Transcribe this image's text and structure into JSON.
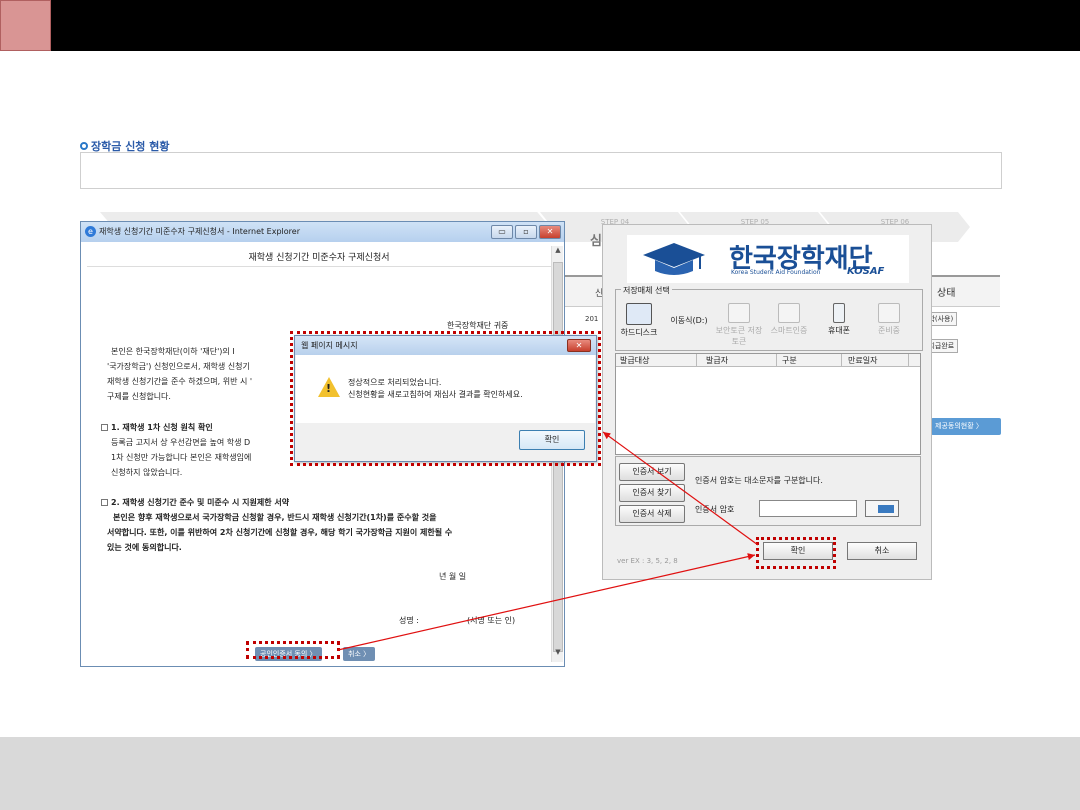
{
  "background": {
    "section_title": "장학금 신청 현황",
    "steps": [
      "STEP 04",
      "STEP 05",
      "STEP 06"
    ],
    "step_big": "심",
    "table": {
      "header_col1": "신",
      "header_status": "상태",
      "row1_text": "201",
      "row1_badge": "결학(사용)",
      "row2_badge": "학지급완료"
    },
    "blue_button": "제공동의현황 〉"
  },
  "ie_window": {
    "title": "재학생 신청기간 미준수자 구제신청서 - Internet Explorer",
    "doc_title": "재학생 신청기간 미준수자 구제신청서",
    "doc_to": "한국장학재단 귀중",
    "para1": "본인은  한국장학재단(이하  '재단')의   I",
    "para1b": "'국가장학금') 신청인으로서,  재학생  신청기",
    "para1c": "재학생 신청기간을 준수 하겠으며, 위반 시 '",
    "para1d": "구제를 신청합니다.",
    "sec1_title": "1. 재학생 1차 신청 원칙 확인",
    "sec1_a": "등록금 고지서 상 우선감면을 높여 학생 D",
    "sec1_b": "1차  신청만  가능합니다  본인은  재학생임에",
    "sec1_c": "신청하지 않았습니다.",
    "sec2_title": "2. 재학생 신청기간 준수 및 미준수 시 지원제한 서약",
    "sec2_a": "본인은 향후 재학생으로서 국가장학금 신청할 경우, 반드시 재학생 신청기간(1차)를 준수할 것을",
    "sec2_b": "서약합니다. 또한, 이를 위반하여 2차 신청기간에 신청할 경우, 해당 학기 국가장학금 지원이 제한될 수",
    "sec2_c": "있는 것에 동의합니다.",
    "date": "년      월      일",
    "sign_label": "성명 :",
    "sign_hint": "(서명 또는 인)",
    "btn_cert": "공인인증서 동의 〉",
    "btn_cancel": "취소 〉",
    "min": "▭",
    "max": "▫",
    "close": "✕"
  },
  "cert_window": {
    "logo_name": "한국장학재단",
    "logo_sub": "Korea Student Aid Foundation",
    "logo_kosaf": "KOSAF",
    "media_legend": "저장매체 선택",
    "media": [
      {
        "label": "하드디스크",
        "icon": "hard-disk-icon"
      },
      {
        "label": "이동식(D:)",
        "icon": "removable-icon"
      },
      {
        "label": "보안토큰 저장토큰",
        "icon": "security-token-icon"
      },
      {
        "label": "스마트인증",
        "icon": "smart-cert-icon"
      },
      {
        "label": "휴대폰",
        "icon": "phone-icon"
      },
      {
        "label": "준비중",
        "icon": "pending-icon"
      }
    ],
    "list_headers": [
      "발급대상",
      "발급자",
      "구분",
      "만료일자"
    ],
    "btn_view": "인증서 보기",
    "btn_find": "인증서 찾기",
    "btn_delete": "인증서 삭제",
    "case_hint": "인증서 암호는 대소문자를 구분합니다.",
    "pw_label": "인증서 암호",
    "version": "ver EX : 3, 5, 2, 8",
    "ok": "확인",
    "cancel": "취소"
  },
  "message_dialog": {
    "title": "웹 페이지 메시지",
    "line1": "정상적으로 처리되었습니다.",
    "line2": "신청현황을 새로고침하여 재심사 결과를 확인하세요.",
    "ok": "확인",
    "close": "✕",
    "warn": "!"
  },
  "colors": {
    "highlight": "#c00000",
    "arrow": "#e01010"
  }
}
